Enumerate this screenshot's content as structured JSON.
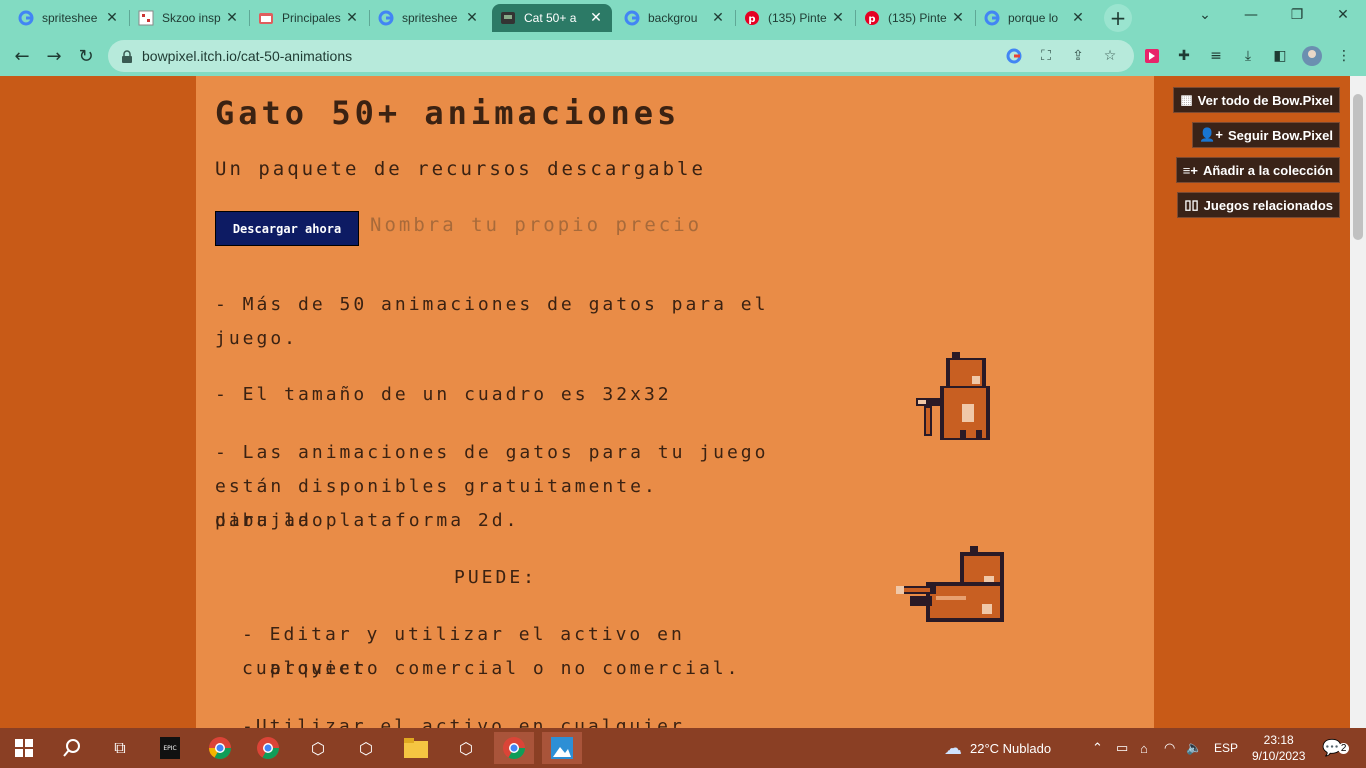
{
  "browser": {
    "tabs": [
      {
        "label": "spriteshee",
        "icon": "google-icon"
      },
      {
        "label": "Skzoo insp",
        "icon": "site-icon"
      },
      {
        "label": "Principales",
        "icon": "site-icon"
      },
      {
        "label": "spriteshee",
        "icon": "google-icon"
      },
      {
        "label": "Cat 50+ a",
        "icon": "itch-icon"
      },
      {
        "label": "backgrou",
        "icon": "google-icon"
      },
      {
        "label": "(135) Pinte",
        "icon": "pinterest-icon"
      },
      {
        "label": "(135) Pinte",
        "icon": "pinterest-icon"
      },
      {
        "label": "porque lo",
        "icon": "google-icon"
      }
    ],
    "url": "bowpixel.itch.io/cat-50-animations"
  },
  "page": {
    "title": "Gato 50+ animaciones",
    "subtitle": "Un paquete de recursos descargable",
    "download_label": "Descargar ahora",
    "price_label": "Nombra tu propio precio",
    "desc_1a": "- Más de 50 animaciones de gatos para el",
    "desc_1b": "juego.",
    "desc_2": "- El tamaño de un cuadro es 32x32",
    "desc_3a": "-  Las animaciones de gatos para tu juego",
    "desc_3b": "están disponibles gratuitamente. dibujado",
    "desc_3c": "para la plataforma 2d.",
    "can_heading": "PUEDE:",
    "can_1a": "- Editar y utilizar el activo en cualquier",
    "can_1b": "proyecto comercial o no comercial.",
    "can_2": "-Utilizar el activo en cualquier proyecto"
  },
  "sidebar": {
    "view_all": "Ver todo de Bow.Pixel",
    "follow": "Seguir Bow.Pixel",
    "add_collection": "Añadir a la colección",
    "related": "Juegos relacionados"
  },
  "taskbar": {
    "weather": "22°C  Nublado",
    "lang": "ESP",
    "time": "23:18",
    "date": "9/10/2023",
    "notifications": "2"
  }
}
